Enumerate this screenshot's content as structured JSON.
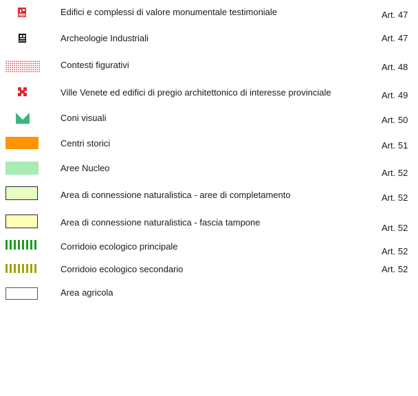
{
  "legend": {
    "items": [
      {
        "label": "Edifici e complessi di valore monumentale testimoniale",
        "article": "Art. 47",
        "icon": "monument-icon",
        "color": "#e0262b"
      },
      {
        "label": "Archeologie Industriali",
        "article": "Art. 47",
        "icon": "factory-icon",
        "color": "#111111"
      },
      {
        "label": "Contesti figurativi",
        "article": "Art. 48",
        "icon": "red-dotted-area",
        "color": "#e0262b"
      },
      {
        "label": "Ville Venete ed edifici di pregio architettonico di interesse provinciale",
        "article": "Art. 49",
        "icon": "villa-icon",
        "color": "#e0262b"
      },
      {
        "label": "Coni visuali",
        "article": "Art. 50",
        "icon": "visual-cone-icon",
        "color": "#3cb878"
      },
      {
        "label": "Centri storici",
        "article": "Art. 51",
        "icon": "orange-swatch",
        "color": "#ff9400"
      },
      {
        "label": "Aree Nucleo",
        "article": "Art. 52",
        "icon": "light-green-swatch",
        "color": "#a8ecb4"
      },
      {
        "label": "Area di connessione naturalistica - aree di completamento",
        "article": "Art. 52",
        "icon": "pale-green-swatch",
        "color": "#e6ffc0"
      },
      {
        "label": "Area di connessione naturalistica - fascia tampone",
        "article": "Art. 52",
        "icon": "pale-yellow-swatch",
        "color": "#ffffb8"
      },
      {
        "label": "Corridoio ecologico principale",
        "article": "Art. 52",
        "icon": "green-hatched-line",
        "color": "#1f9a1f"
      },
      {
        "label": "Corridoio ecologico secondario",
        "article": "Art. 52",
        "icon": "olive-hatched-line",
        "color": "#a3a300"
      },
      {
        "label": "Area agricola",
        "article": "",
        "icon": "white-swatch",
        "color": "#ffffff"
      }
    ]
  }
}
